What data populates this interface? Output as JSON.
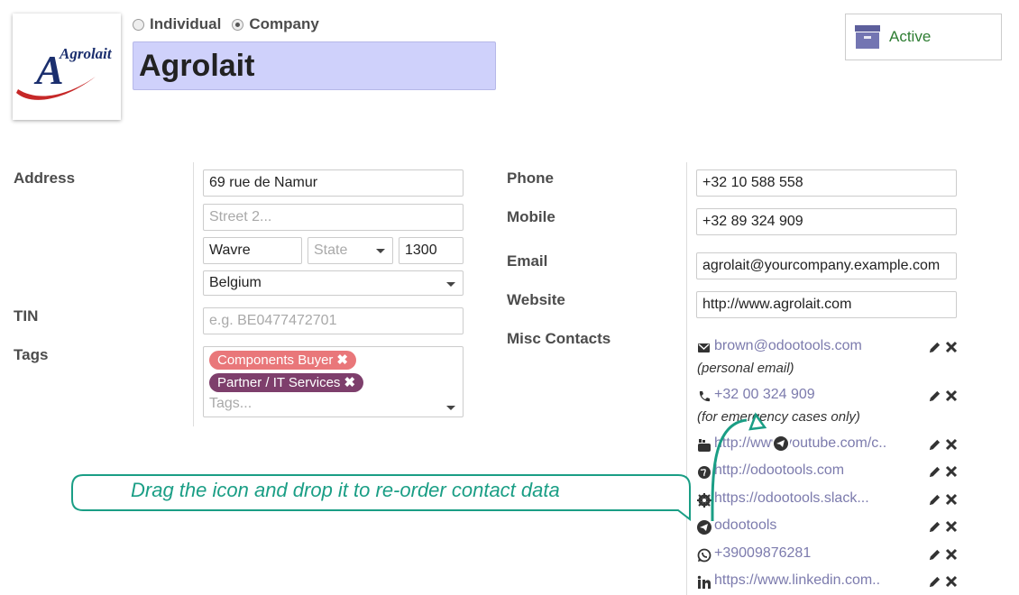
{
  "header": {
    "logo_text": "Agrolait",
    "type_options": [
      {
        "label": "Individual",
        "checked": false
      },
      {
        "label": "Company",
        "checked": true
      }
    ],
    "company_name": "Agrolait",
    "active_button_label": "Active"
  },
  "left": {
    "address_label": "Address",
    "street": "69 rue de Namur",
    "street2_placeholder": "Street 2...",
    "city": "Wavre",
    "state_placeholder": "State",
    "zip": "1300",
    "country": "Belgium",
    "tin_label": "TIN",
    "tin_placeholder": "e.g. BE0477472701",
    "tags_label": "Tags",
    "tags": [
      {
        "label": "Components Buyer",
        "color": "#e9777a"
      },
      {
        "label": "Partner / IT Services",
        "color": "#7e3f6c"
      }
    ],
    "tags_placeholder": "Tags..."
  },
  "right": {
    "phone_label": "Phone",
    "phone": "+32 10 588 558",
    "mobile_label": "Mobile",
    "mobile": "+32 89 324 909",
    "email_label": "Email",
    "email": "agrolait@yourcompany.example.com",
    "website_label": "Website",
    "website": "http://www.agrolait.com",
    "misc_label": "Misc Contacts",
    "misc": [
      {
        "icon": "envelope-icon",
        "value": "brown@odootools.com",
        "note": "(personal email)"
      },
      {
        "icon": "phone-icon",
        "value": "+32 00 324 909",
        "note": "(for emergency cases only)"
      },
      {
        "icon": "youtube-icon",
        "value": "http://www.youtube.com/c.."
      },
      {
        "icon": "globe-icon",
        "value": "http://odootools.com"
      },
      {
        "icon": "gear-icon",
        "value": "https://odootools.slack..."
      },
      {
        "icon": "telegram-icon",
        "value": "odootools"
      },
      {
        "icon": "whatsapp-icon",
        "value": "+39009876281"
      },
      {
        "icon": "linkedin-icon",
        "value": "https://www.linkedin.com.."
      }
    ]
  },
  "tooltip": {
    "text": "Drag the icon and drop it to re-order contact data",
    "color": "#1a9e85"
  }
}
